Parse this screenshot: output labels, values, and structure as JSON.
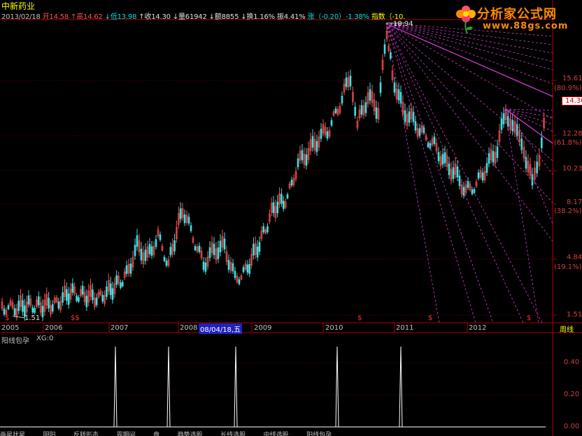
{
  "stock": {
    "name": "中新药业"
  },
  "header": {
    "date": "2013/02/18",
    "open": "开14.58",
    "high": "↑高14.62",
    "low": "↓低13.98",
    "close": "↑收14.30",
    "volume": "↓量61942",
    "amount": "↓额8855",
    "turnover": "↓换1.16%",
    "amplitude": "振4.41%",
    "change": "涨（-0.20）-1.38%",
    "index": "指数（-10."
  },
  "logo": {
    "title": "分析家公式网",
    "url": "www.88gs.com"
  },
  "chart_data": {
    "type": "candlestick",
    "period": "周线",
    "y_axis_labels": [
      "15.61",
      "12.28",
      "10.23",
      "8.17",
      "4.84",
      "1.51"
    ],
    "y_axis_pct": [
      "(80.9%)",
      "(61.8%)",
      "(38.2%)",
      "(19.1%)"
    ],
    "current_price": "14.30",
    "high_marker": "18.94",
    "low_marker": "1.51",
    "x_axis_labels": [
      "2005",
      "2006",
      "2007",
      "2008",
      "2009",
      "2010",
      "2011",
      "2012"
    ],
    "cursor_date": "08/04/18,五",
    "signal_marker": "$",
    "signal_marker_alt": "$$"
  },
  "indicator": {
    "title": "阳线包孕",
    "value_label": "XG:0",
    "y_labels": [
      "0.40",
      "0.20",
      "0.00"
    ]
  },
  "tabs": [
    "画星状星",
    "阴阳",
    "反转形态",
    "周期间",
    "盘",
    "趋势选股",
    "长线选股",
    "中线选股",
    "阳线包孕"
  ]
}
